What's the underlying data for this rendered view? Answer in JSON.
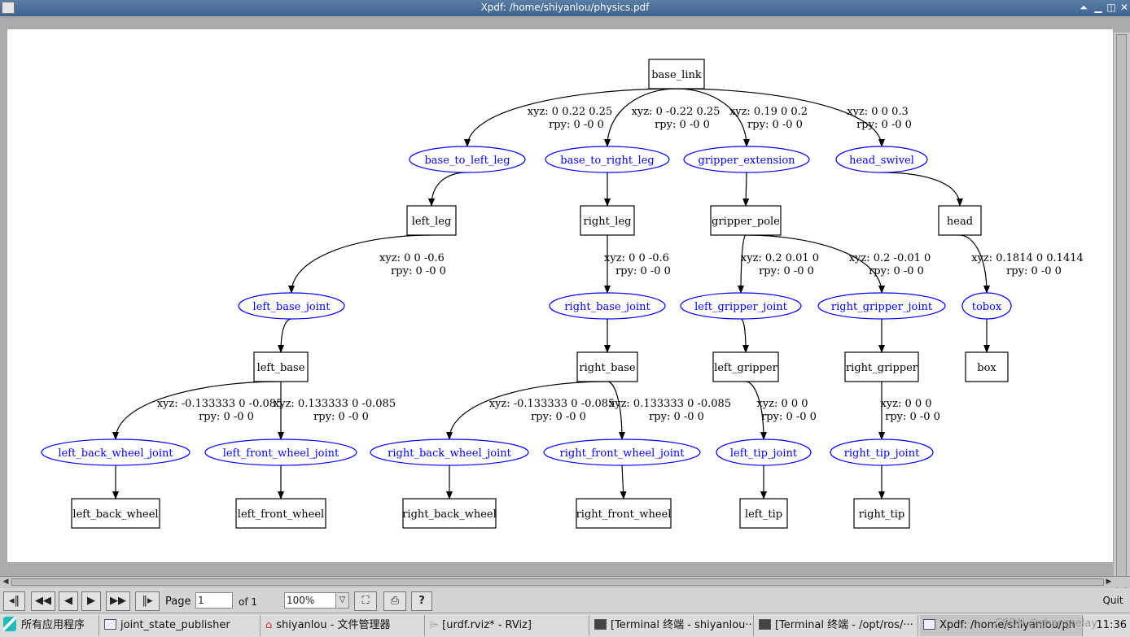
{
  "window": {
    "title": "Xpdf: /home/shiyanlou/physics.pdf"
  },
  "graph": {
    "nodes": [
      {
        "id": "base_link",
        "label": "base_link",
        "kind": "link"
      },
      {
        "id": "base_to_left_leg",
        "label": "base_to_left_leg",
        "kind": "joint"
      },
      {
        "id": "base_to_right_leg",
        "label": "base_to_right_leg",
        "kind": "joint"
      },
      {
        "id": "gripper_extension",
        "label": "gripper_extension",
        "kind": "joint"
      },
      {
        "id": "head_swivel",
        "label": "head_swivel",
        "kind": "joint"
      },
      {
        "id": "left_leg",
        "label": "left_leg",
        "kind": "link"
      },
      {
        "id": "right_leg",
        "label": "right_leg",
        "kind": "link"
      },
      {
        "id": "gripper_pole",
        "label": "gripper_pole",
        "kind": "link"
      },
      {
        "id": "head",
        "label": "head",
        "kind": "link"
      },
      {
        "id": "left_base_joint",
        "label": "left_base_joint",
        "kind": "joint"
      },
      {
        "id": "right_base_joint",
        "label": "right_base_joint",
        "kind": "joint"
      },
      {
        "id": "left_gripper_joint",
        "label": "left_gripper_joint",
        "kind": "joint"
      },
      {
        "id": "right_gripper_joint",
        "label": "right_gripper_joint",
        "kind": "joint"
      },
      {
        "id": "tobox",
        "label": "tobox",
        "kind": "joint"
      },
      {
        "id": "left_base",
        "label": "left_base",
        "kind": "link"
      },
      {
        "id": "right_base",
        "label": "right_base",
        "kind": "link"
      },
      {
        "id": "left_gripper",
        "label": "left_gripper",
        "kind": "link"
      },
      {
        "id": "right_gripper",
        "label": "right_gripper",
        "kind": "link"
      },
      {
        "id": "box",
        "label": "box",
        "kind": "link"
      },
      {
        "id": "left_back_wheel_joint",
        "label": "left_back_wheel_joint",
        "kind": "joint"
      },
      {
        "id": "left_front_wheel_joint",
        "label": "left_front_wheel_joint",
        "kind": "joint"
      },
      {
        "id": "right_back_wheel_joint",
        "label": "right_back_wheel_joint",
        "kind": "joint"
      },
      {
        "id": "right_front_wheel_joint",
        "label": "right_front_wheel_joint",
        "kind": "joint"
      },
      {
        "id": "left_tip_joint",
        "label": "left_tip_joint",
        "kind": "joint"
      },
      {
        "id": "right_tip_joint",
        "label": "right_tip_joint",
        "kind": "joint"
      },
      {
        "id": "left_back_wheel",
        "label": "left_back_wheel",
        "kind": "link"
      },
      {
        "id": "left_front_wheel",
        "label": "left_front_wheel",
        "kind": "link"
      },
      {
        "id": "right_back_wheel",
        "label": "right_back_wheel",
        "kind": "link"
      },
      {
        "id": "right_front_wheel",
        "label": "right_front_wheel",
        "kind": "link"
      },
      {
        "id": "left_tip",
        "label": "left_tip",
        "kind": "link"
      },
      {
        "id": "right_tip",
        "label": "right_tip",
        "kind": "link"
      }
    ],
    "edges": [
      {
        "from": "base_link",
        "to": "base_to_left_leg",
        "xyz": "xyz: 0 0.22 0.25",
        "rpy": "rpy: 0 -0 0"
      },
      {
        "from": "base_link",
        "to": "base_to_right_leg",
        "xyz": "xyz: 0 -0.22 0.25",
        "rpy": "rpy: 0 -0 0"
      },
      {
        "from": "base_link",
        "to": "gripper_extension",
        "xyz": "xyz: 0.19 0 0.2",
        "rpy": "rpy: 0 -0 0"
      },
      {
        "from": "base_link",
        "to": "head_swivel",
        "xyz": "xyz: 0 0 0.3",
        "rpy": "rpy: 0 -0 0"
      },
      {
        "from": "base_to_left_leg",
        "to": "left_leg"
      },
      {
        "from": "base_to_right_leg",
        "to": "right_leg"
      },
      {
        "from": "gripper_extension",
        "to": "gripper_pole"
      },
      {
        "from": "head_swivel",
        "to": "head"
      },
      {
        "from": "left_leg",
        "to": "left_base_joint",
        "xyz": "xyz: 0 0 -0.6",
        "rpy": "rpy: 0 -0 0"
      },
      {
        "from": "right_leg",
        "to": "right_base_joint",
        "xyz": "xyz: 0 0 -0.6",
        "rpy": "rpy: 0 -0 0"
      },
      {
        "from": "gripper_pole",
        "to": "left_gripper_joint",
        "xyz": "xyz: 0.2 0.01 0",
        "rpy": "rpy: 0 -0 0"
      },
      {
        "from": "gripper_pole",
        "to": "right_gripper_joint",
        "xyz": "xyz: 0.2 -0.01 0",
        "rpy": "rpy: 0 -0 0"
      },
      {
        "from": "head",
        "to": "tobox",
        "xyz": "xyz: 0.1814 0 0.1414",
        "rpy": "rpy: 0 -0 0"
      },
      {
        "from": "left_base_joint",
        "to": "left_base"
      },
      {
        "from": "right_base_joint",
        "to": "right_base"
      },
      {
        "from": "left_gripper_joint",
        "to": "left_gripper"
      },
      {
        "from": "right_gripper_joint",
        "to": "right_gripper"
      },
      {
        "from": "tobox",
        "to": "box"
      },
      {
        "from": "left_base",
        "to": "left_back_wheel_joint",
        "xyz": "xyz: -0.133333 0 -0.085",
        "rpy": "rpy: 0 -0 0"
      },
      {
        "from": "left_base",
        "to": "left_front_wheel_joint",
        "xyz": "xyz: 0.133333 0 -0.085",
        "rpy": "rpy: 0 -0 0"
      },
      {
        "from": "right_base",
        "to": "right_back_wheel_joint",
        "xyz": "xyz: -0.133333 0 -0.085",
        "rpy": "rpy: 0 -0 0"
      },
      {
        "from": "right_base",
        "to": "right_front_wheel_joint",
        "xyz": "xyz: 0.133333 0 -0.085",
        "rpy": "rpy: 0 -0 0"
      },
      {
        "from": "left_gripper",
        "to": "left_tip_joint",
        "xyz": "xyz: 0 0 0",
        "rpy": "rpy: 0 -0 0"
      },
      {
        "from": "right_gripper",
        "to": "right_tip_joint",
        "xyz": "xyz: 0 0 0",
        "rpy": "rpy: 0 -0 0"
      },
      {
        "from": "left_back_wheel_joint",
        "to": "left_back_wheel"
      },
      {
        "from": "left_front_wheel_joint",
        "to": "left_front_wheel"
      },
      {
        "from": "right_back_wheel_joint",
        "to": "right_back_wheel"
      },
      {
        "from": "right_front_wheel_joint",
        "to": "right_front_wheel"
      },
      {
        "from": "left_tip_joint",
        "to": "left_tip"
      },
      {
        "from": "right_tip_joint",
        "to": "right_tip"
      }
    ],
    "colors": {
      "link": "#000000",
      "joint": "#0000ff"
    }
  },
  "toolbar": {
    "page_label": "Page",
    "page_value": "1",
    "of_label": "of 1",
    "zoom_value": "100%",
    "quit_label": "Quit"
  },
  "taskbar": {
    "start_label": "所有应用程序",
    "tasks": [
      "joint_state_publisher",
      "shiyanlou - 文件管理器",
      "[urdf.rviz* - RViz]",
      "[Terminal 终端 - shiyanlou···",
      "[Terminal 终端 - /opt/ros/···",
      "Xpdf: /home/shiyanlou/ph"
    ],
    "clock": "11:36",
    "watermark": "CSDN @zhangrelay"
  }
}
